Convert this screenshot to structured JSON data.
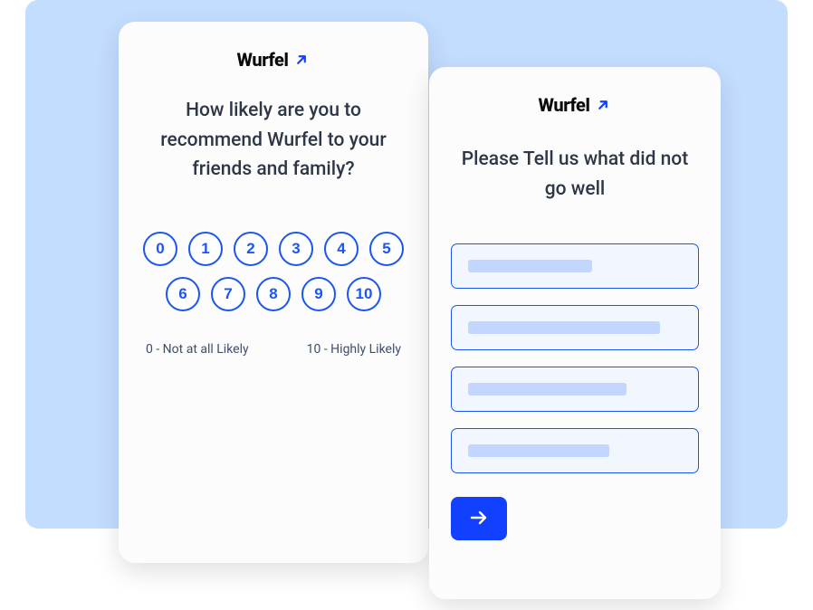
{
  "brand": {
    "name": "Wurfel"
  },
  "nps_card": {
    "question": "How likely are you to recommend Wurfel to your friends and family?",
    "scores": [
      "0",
      "1",
      "2",
      "3",
      "4",
      "5",
      "6",
      "7",
      "8",
      "9",
      "10"
    ],
    "legend_low": "0 - Not at all Likely",
    "legend_high": "10 - Highly Likely"
  },
  "feedback_card": {
    "question": "Please Tell us what did not go well",
    "option_widths_pct": [
      58,
      90,
      74,
      66
    ]
  }
}
